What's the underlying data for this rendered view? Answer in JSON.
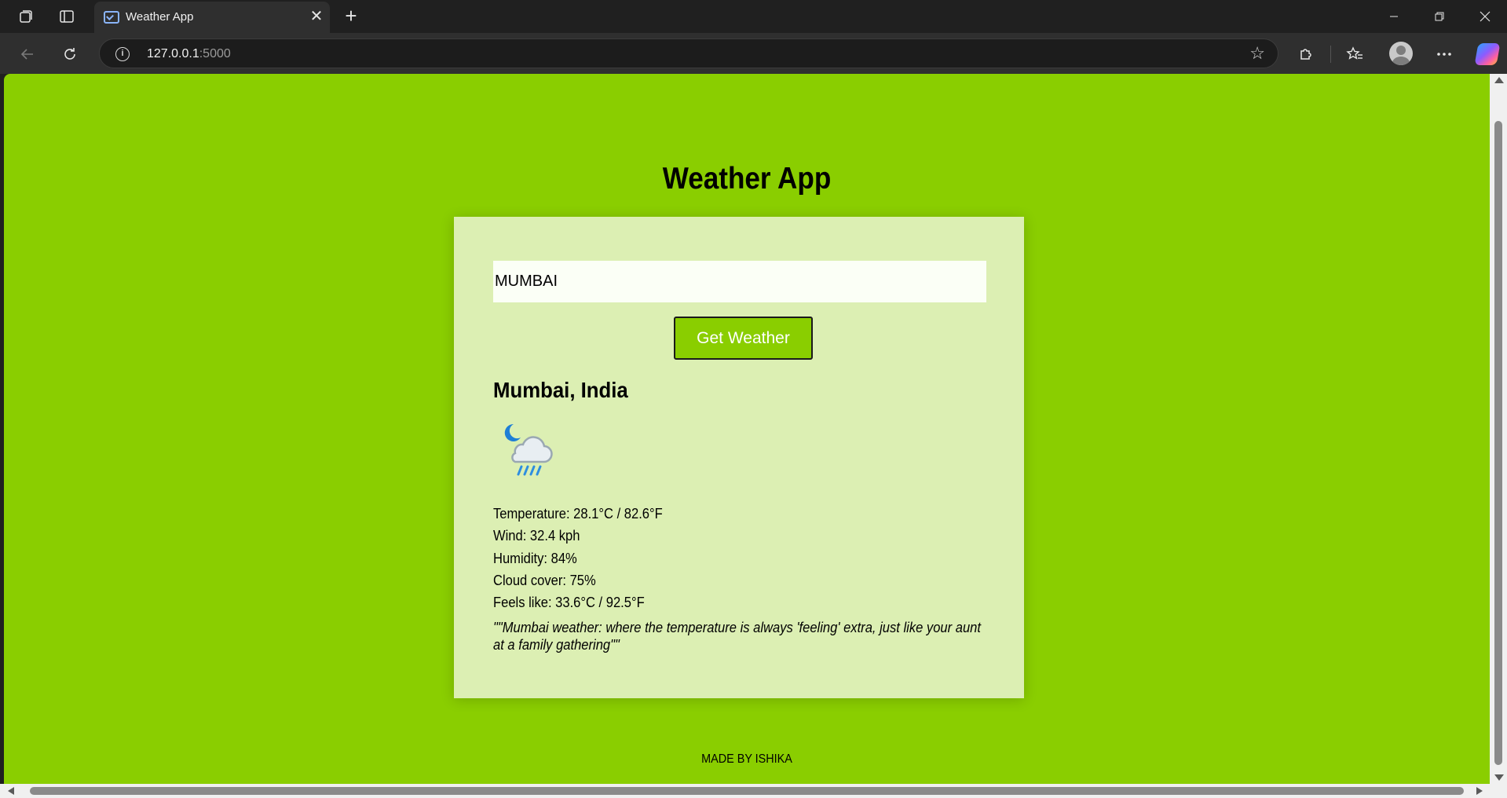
{
  "browser": {
    "tab_title": "Weather App",
    "url_host": "127.0.0.1",
    "url_port": ":5000",
    "icons": {
      "workspaces": "workspaces-icon",
      "tab_actions": "tab-actions-icon",
      "favicon": "page-favicon-icon",
      "close_tab": "close-icon",
      "new_tab": "plus-icon",
      "back": "back-arrow-icon",
      "refresh": "refresh-icon",
      "site_info": "info-icon",
      "favorite": "star-icon",
      "extensions": "puzzle-icon",
      "favorites": "favorites-icon",
      "profile": "avatar-icon",
      "menu": "more-icon",
      "copilot": "copilot-icon",
      "minimize": "minimize-icon",
      "restore": "restore-icon",
      "close_window": "close-icon"
    }
  },
  "page": {
    "background": "#8ace00",
    "title": "Weather App",
    "search": {
      "value": "MUMBAI"
    },
    "button": {
      "label": "Get Weather",
      "color": "#8ace00"
    },
    "result": {
      "location": "Mumbai, India",
      "icon": "night-rain-cloud-icon",
      "temperature": "Temperature: 28.1°C / 82.6°F",
      "wind": "Wind: 32.4 kph",
      "humidity": "Humidity: 84%",
      "cloud_cover": "Cloud cover: 75%",
      "feels_like": "Feels like: 33.6°C / 92.5°F",
      "quote": "\"\"Mumbai weather: where the temperature is always 'feeling' extra, just like your aunt at a family gathering\"\""
    },
    "card_background": "#dcefb3",
    "footer": "MADE BY ISHIKA"
  }
}
